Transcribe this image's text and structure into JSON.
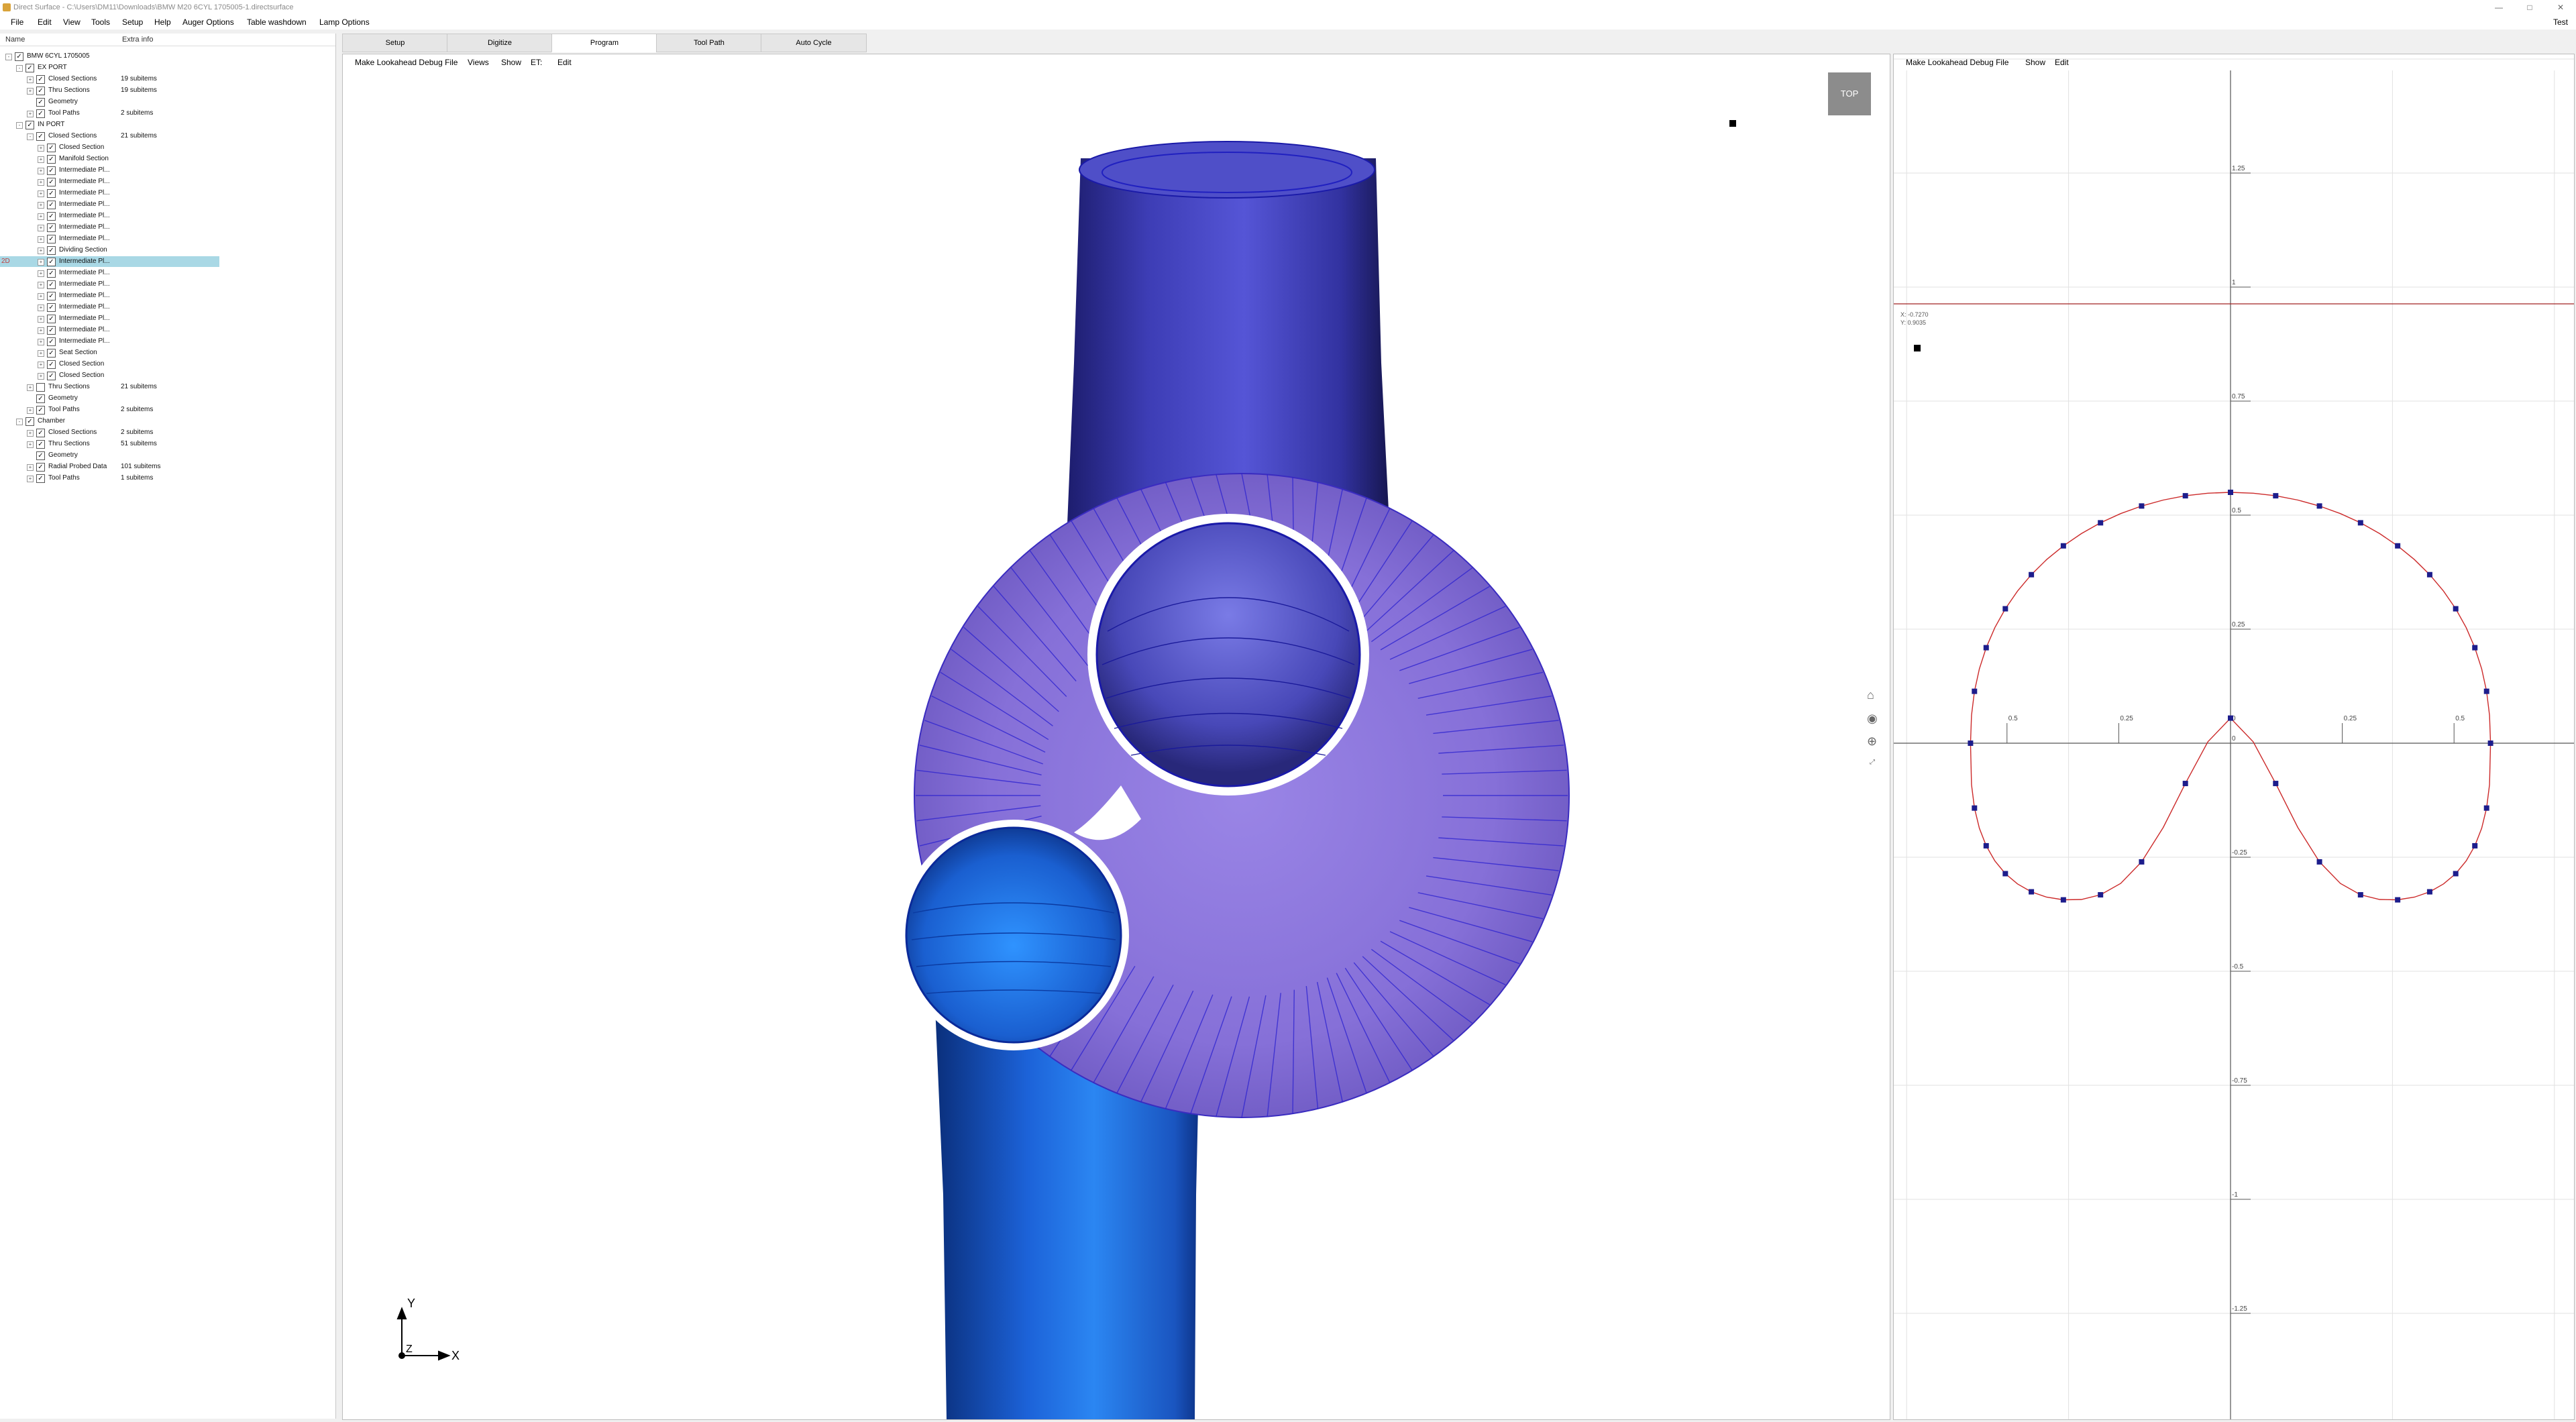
{
  "window": {
    "title": "Direct Surface - C:\\Users\\DM11\\Downloads\\BMW M20 6CYL 1705005-1.directsurface",
    "buttons": [
      "—",
      "□",
      "✕"
    ]
  },
  "menu": {
    "items": [
      "File",
      "Edit",
      "View",
      "Tools",
      "Setup",
      "Help",
      "Auger Options",
      "Table washdown",
      "Lamp Options"
    ],
    "right": "Test"
  },
  "tree": {
    "col_name": "Name",
    "col_extra": "Extra info",
    "rows": [
      {
        "label": "BMW 6CYL 1705005",
        "extra": "",
        "level": 0,
        "expander": "-",
        "checked": true
      },
      {
        "label": "EX PORT",
        "extra": "",
        "level": 1,
        "expander": "-",
        "checked": true
      },
      {
        "label": "Closed Sections",
        "extra": "19 subitems",
        "level": 2,
        "expander": "+",
        "checked": true
      },
      {
        "label": "Thru Sections",
        "extra": "19 subitems",
        "level": 2,
        "expander": "+",
        "checked": true
      },
      {
        "label": "Geometry",
        "extra": "",
        "level": 2,
        "expander": "",
        "checked": true
      },
      {
        "label": "Tool Paths",
        "extra": "2 subitems",
        "level": 2,
        "expander": "+",
        "checked": true
      },
      {
        "label": "IN PORT",
        "extra": "",
        "level": 1,
        "expander": "-",
        "checked": true
      },
      {
        "label": "Closed Sections",
        "extra": "21 subitems",
        "level": 2,
        "expander": "-",
        "checked": true
      },
      {
        "label": "Closed Section",
        "extra": "",
        "level": 3,
        "expander": "+",
        "checked": true
      },
      {
        "label": "Manifold Section",
        "extra": "",
        "level": 3,
        "expander": "+",
        "checked": true
      },
      {
        "label": "Intermediate Pl...",
        "extra": "",
        "level": 3,
        "expander": "+",
        "checked": true
      },
      {
        "label": "Intermediate Pl...",
        "extra": "",
        "level": 3,
        "expander": "+",
        "checked": true
      },
      {
        "label": "Intermediate Pl...",
        "extra": "",
        "level": 3,
        "expander": "+",
        "checked": true
      },
      {
        "label": "Intermediate Pl...",
        "extra": "",
        "level": 3,
        "expander": "+",
        "checked": true
      },
      {
        "label": "Intermediate Pl...",
        "extra": "",
        "level": 3,
        "expander": "+",
        "checked": true
      },
      {
        "label": "Intermediate Pl...",
        "extra": "",
        "level": 3,
        "expander": "+",
        "checked": true
      },
      {
        "label": "Intermediate Pl...",
        "extra": "",
        "level": 3,
        "expander": "+",
        "checked": true
      },
      {
        "label": "Dividing Section",
        "extra": "",
        "level": 3,
        "expander": "+",
        "checked": true
      },
      {
        "label": "Intermediate Pl...",
        "extra": "",
        "level": 3,
        "expander": "+",
        "checked": true,
        "selected": true,
        "tag": "2D"
      },
      {
        "label": "Intermediate Pl...",
        "extra": "",
        "level": 3,
        "expander": "+",
        "checked": true
      },
      {
        "label": "Intermediate Pl...",
        "extra": "",
        "level": 3,
        "expander": "+",
        "checked": true
      },
      {
        "label": "Intermediate Pl...",
        "extra": "",
        "level": 3,
        "expander": "+",
        "checked": true
      },
      {
        "label": "Intermediate Pl...",
        "extra": "",
        "level": 3,
        "expander": "+",
        "checked": true
      },
      {
        "label": "Intermediate Pl...",
        "extra": "",
        "level": 3,
        "expander": "+",
        "checked": true
      },
      {
        "label": "Intermediate Pl...",
        "extra": "",
        "level": 3,
        "expander": "+",
        "checked": true
      },
      {
        "label": "Intermediate Pl...",
        "extra": "",
        "level": 3,
        "expander": "+",
        "checked": true
      },
      {
        "label": "Seat Section",
        "extra": "",
        "level": 3,
        "expander": "+",
        "checked": true
      },
      {
        "label": "Closed Section",
        "extra": "",
        "level": 3,
        "expander": "+",
        "checked": true
      },
      {
        "label": "Closed Section",
        "extra": "",
        "level": 3,
        "expander": "+",
        "checked": true
      },
      {
        "label": "Thru Sections",
        "extra": "21 subitems",
        "level": 2,
        "expander": "+",
        "checked": false
      },
      {
        "label": "Geometry",
        "extra": "",
        "level": 2,
        "expander": "",
        "checked": true
      },
      {
        "label": "Tool Paths",
        "extra": "2 subitems",
        "level": 2,
        "expander": "+",
        "checked": true
      },
      {
        "label": "Chamber",
        "extra": "",
        "level": 1,
        "expander": "-",
        "checked": true
      },
      {
        "label": "Closed Sections",
        "extra": "2 subitems",
        "level": 2,
        "expander": "+",
        "checked": true
      },
      {
        "label": "Thru Sections",
        "extra": "51 subitems",
        "level": 2,
        "expander": "+",
        "checked": true
      },
      {
        "label": "Geometry",
        "extra": "",
        "level": 2,
        "expander": "",
        "checked": true
      },
      {
        "label": "Radial Probed Data",
        "extra": "101 subitems",
        "level": 2,
        "expander": "+",
        "checked": true
      },
      {
        "label": "Tool Paths",
        "extra": "1 subitems",
        "level": 2,
        "expander": "+",
        "checked": true
      }
    ]
  },
  "tabs": [
    {
      "label": "Setup",
      "active": false
    },
    {
      "label": "Digitize",
      "active": false
    },
    {
      "label": "Program",
      "active": true
    },
    {
      "label": "Tool Path",
      "active": false
    },
    {
      "label": "Auto Cycle",
      "active": false
    }
  ],
  "viewport": {
    "toolbar": [
      "Make Lookahead Debug File",
      "Views",
      "Show",
      "ET:",
      "Edit"
    ],
    "view_label": "TOP",
    "axis": {
      "y": "Y",
      "x": "X",
      "z": "Z"
    },
    "colors": {
      "runner_top": "#4646c8",
      "runner_bottom": "#1f6ee6",
      "chamber": "#8a73d8",
      "mesh": "#2a20d0"
    }
  },
  "plot": {
    "toolbar": [
      "Make Lookahead Debug File",
      "Show",
      "Edit"
    ],
    "cursor_x": "X: -0.7270",
    "cursor_y": "Y: 0.9035",
    "y_ticks": [
      "1.25",
      "1",
      "0.75",
      "0.5",
      "0.25",
      "0",
      "-0.25",
      "-0.5",
      "-0.75",
      "-1",
      "-1.25"
    ],
    "x_ticks": [
      "0.5",
      "0.25",
      "0",
      "0.25",
      "0.5"
    ],
    "colors": {
      "curve": "#cc2a2a",
      "points": "#1d1d8c",
      "cursor_line": "#a02020"
    }
  }
}
